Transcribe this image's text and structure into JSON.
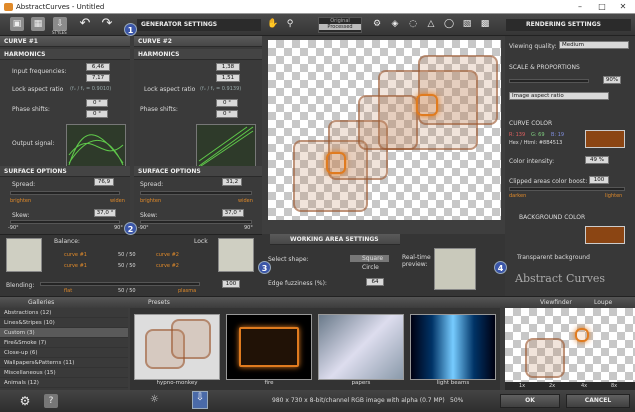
{
  "window": {
    "title": "AbstractCurves - Untitled"
  },
  "toolbar": {
    "styles_label": "STYLES",
    "original_label": "Original",
    "processed_label": "Processed"
  },
  "generator": {
    "header": "GENERATOR SETTINGS",
    "curve1": "CURVE #1",
    "curve2": "CURVE #2",
    "harmonics": "HARMONICS",
    "input_freq": "Input frequencies:",
    "lock_ratio": "Lock aspect ratio",
    "c1": {
      "fx": "6,46",
      "fy": "7,17",
      "ratio": "(fₓ / fᵧ = 0.9010)",
      "px": "0 °",
      "py": "0 °",
      "spread": "76,9",
      "skew": "37,0 °"
    },
    "c2": {
      "fx": "1,38",
      "fy": "1,51",
      "ratio": "(fₓ / fᵧ = 0.9139)",
      "px": "0 °",
      "py": "0 °",
      "spread": "31,2",
      "skew": "37,0 °"
    },
    "phase": "Phase shifts:",
    "output": "Output signal:",
    "surface": "SURFACE OPTIONS",
    "spread_lbl": "Spread:",
    "skew_lbl": "Skew:",
    "brighten": "brighten",
    "widen": "widen",
    "m90": "-90°",
    "p90": "90°",
    "balance": "Balance:",
    "lock": "Lock",
    "curve1_lbl": "curve #1",
    "curve2_lbl": "curve #2",
    "bal_x": "50 / 50",
    "bal_y": "50 / 50",
    "blending": "Blending:",
    "flat": "flat",
    "plasma": "plasma",
    "blend_val": "50 / 50",
    "blend_num": "100"
  },
  "working": {
    "header": "WORKING AREA SETTINGS",
    "shape": "Select shape:",
    "square": "Square",
    "circle": "Circle",
    "fuzz": "Edge fuzziness (%):",
    "fuzz_val": "64",
    "realtime": "Real-time preview:"
  },
  "rendering": {
    "header": "RENDERING SETTINGS",
    "quality": "Viewing quality:",
    "quality_val": "Medium",
    "scale": "SCALE & PROPORTIONS",
    "scale_val": "90%",
    "aspect": "Image aspect ratio",
    "curve_color": "CURVE COLOR",
    "r": "R: 139",
    "g": "G: 69",
    "b": "B: 19",
    "hex": "Hex / Html: #8B4513",
    "intensity": "Color intensity:",
    "intensity_val": "49 %",
    "boost": "Clipped areas color boost:",
    "boost_val": "100",
    "darken": "darken",
    "lighten": "lighten",
    "bg_color": "BACKGROUND COLOR",
    "transparent": "Transparent background",
    "brand": "Abstract Curves"
  },
  "badges": [
    "1",
    "2",
    "3",
    "4"
  ],
  "bottom": {
    "galleries": "Galleries",
    "presets": "Presets",
    "viewfinder": "Viewfinder",
    "loupe": "Loupe",
    "categories": [
      "Abstractions (12)",
      "Lines&Stripes (10)",
      "Custom (3)",
      "Fire&Smoke (7)",
      "Close-up (6)",
      "Wallpapers&Patterns (11)",
      "Miscellaneous (15)",
      "Animals (12)"
    ],
    "thumbs": [
      "hypno-monkey",
      "fire",
      "papers",
      "light beams"
    ],
    "zooms": [
      "1x",
      "2x",
      "4x",
      "8x"
    ],
    "status": "980 x 730 x 8-bit/channel RGB image with alpha  (0.7 MP)",
    "zoom": "50%",
    "ok": "OK",
    "cancel": "CANCEL"
  },
  "colors": {
    "accent": "#e07b1f",
    "swatch": "#8B4513",
    "badge": "#3b56a8"
  }
}
